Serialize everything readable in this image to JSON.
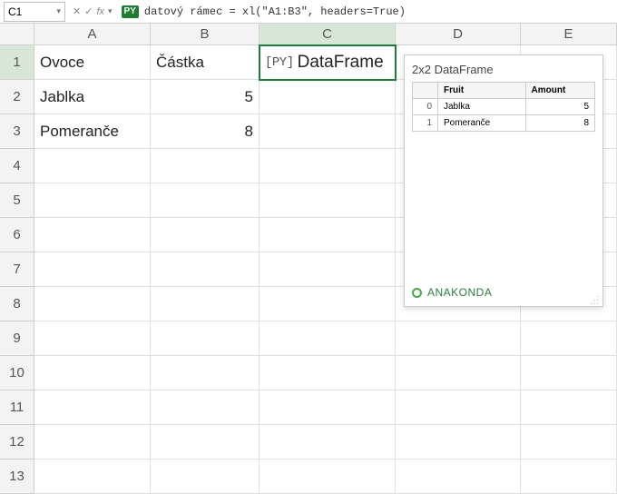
{
  "formula_bar": {
    "cell_ref": "C1",
    "python_badge": "PY",
    "formula": "datový rámec = xl(\"A1:B3\", headers=True)"
  },
  "columns": [
    "A",
    "B",
    "C",
    "D",
    "E"
  ],
  "active_col": "C",
  "active_row": "1",
  "rows": [
    "1",
    "2",
    "3",
    "4",
    "5",
    "6",
    "7",
    "8",
    "9",
    "10",
    "11",
    "12",
    "13"
  ],
  "cells": {
    "A1": "Ovoce",
    "B1": "Částka",
    "A2": "Jablka",
    "B2": "5",
    "A3": "Pomeranče",
    "B3": "8",
    "C1_prefix": "[PY]",
    "C1_label": "DataFrame"
  },
  "tooltip": {
    "title": "2x2 DataFrame",
    "headers": [
      "",
      "Fruit",
      "Amount"
    ],
    "rows": [
      {
        "idx": "0",
        "fruit": "Jablka",
        "amount": "5"
      },
      {
        "idx": "1",
        "fruit": "Pomeranče",
        "amount": "8"
      }
    ],
    "footer": "ANAKONDA"
  }
}
